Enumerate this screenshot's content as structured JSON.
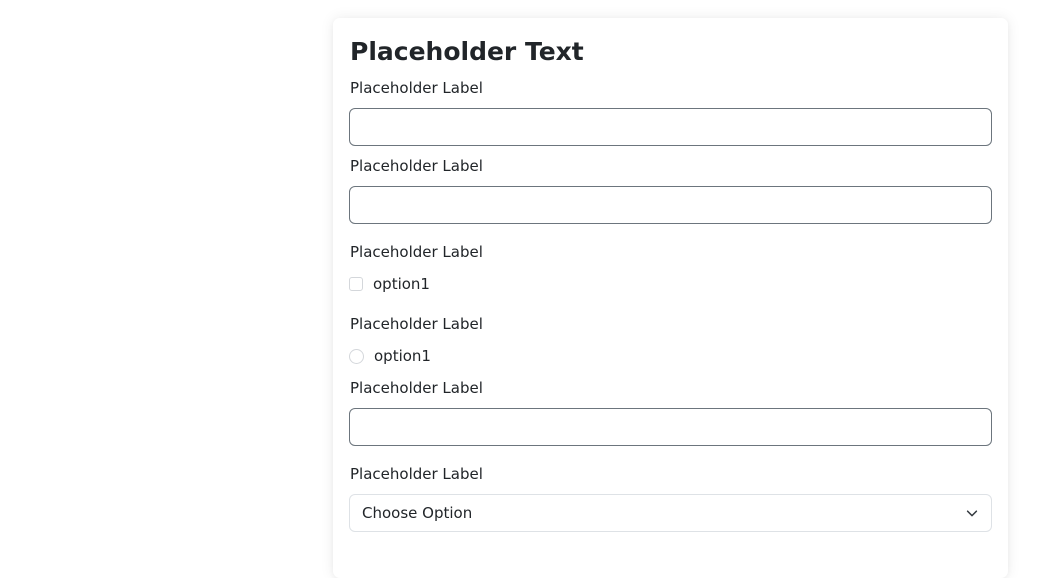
{
  "form": {
    "title": "Placeholder Text",
    "fields": [
      {
        "label": "Placeholder Label",
        "type": "text",
        "value": "",
        "placeholder": ""
      },
      {
        "label": "Placeholder Label",
        "type": "text",
        "value": "",
        "placeholder": ""
      },
      {
        "label": "Placeholder Label",
        "type": "checkbox",
        "option": "option1",
        "checked": false
      },
      {
        "label": "Placeholder Label",
        "type": "radio",
        "option": "option1",
        "checked": false
      },
      {
        "label": "Placeholder Label",
        "type": "text",
        "value": "",
        "placeholder": ""
      },
      {
        "label": "Placeholder Label",
        "type": "select",
        "selected": "Choose Option",
        "icon": "chevron-down-icon"
      }
    ]
  },
  "colors": {
    "input_border": "#6c757d",
    "select_border": "#dee2e6",
    "control_border": "#d4d7db",
    "text": "#212529"
  }
}
